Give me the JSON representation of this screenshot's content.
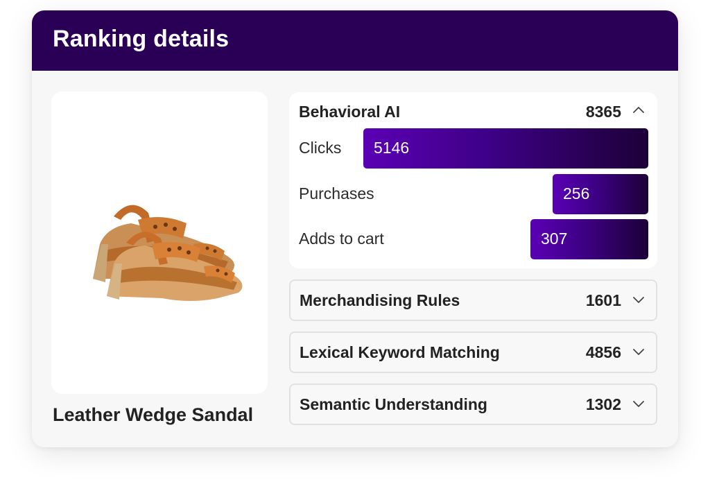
{
  "header": {
    "title": "Ranking details"
  },
  "product": {
    "name": "Leather Wedge Sandal",
    "image_icon": "sandal-product-image"
  },
  "sections": {
    "behavioral": {
      "title": "Behavioral AI",
      "score": "8365",
      "expanded": true,
      "metrics": [
        {
          "label": "Clicks",
          "value": "5146",
          "fill": 1.0
        },
        {
          "label": "Purchases",
          "value": "256",
          "fill": 0.275
        },
        {
          "label": "Adds to cart",
          "value": "307",
          "fill": 0.34
        }
      ]
    },
    "merchandising": {
      "title": "Merchandising Rules",
      "score": "1601",
      "expanded": false
    },
    "lexical": {
      "title": "Lexical Keyword Matching",
      "score": "4856",
      "expanded": false
    },
    "semantic": {
      "title": "Semantic Understanding",
      "score": "1302",
      "expanded": false
    }
  },
  "colors": {
    "header_bg": "#2a0057",
    "bar_start": "#5b00b5",
    "bar_end": "#1d0038"
  }
}
